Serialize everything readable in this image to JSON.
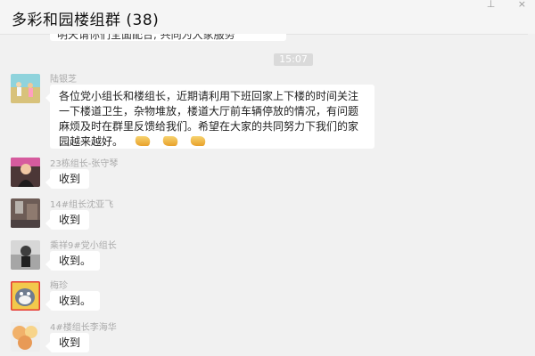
{
  "window": {
    "title": "多彩和园楼组群 (38)",
    "controls": [
      "⊥",
      "×"
    ]
  },
  "chat": {
    "previous_message_fragment": "明天请你们全面配合, 共同为大家服务",
    "time": "15:07",
    "messages": [
      {
        "sender": "陆银芝",
        "text": "各位党小组长和楼组长，近期请利用下班回家上下楼的时间关注一下楼道卫生，杂物堆放，楼道大厅前车辆停放的情况，有问题麻烦及时在群里反馈给我们。希望在大家的共同努力下我们的家园越来越好。",
        "emoji": [
          "clap",
          "clap",
          "clap"
        ]
      },
      {
        "sender": "23栋组长-张守琴",
        "text": "收到"
      },
      {
        "sender": "14#组长沈亚飞",
        "text": "收到"
      },
      {
        "sender": "乘祥9#党小组长",
        "text": "收到。"
      },
      {
        "sender": "梅珍",
        "text": "收到。"
      },
      {
        "sender": "4#楼组长李海华",
        "text": "收到"
      }
    ]
  },
  "colors": {
    "background": "#f1f1f1",
    "bubble": "#ffffff",
    "sender_text": "#aaaaaa",
    "timestamp": "#dadada"
  }
}
